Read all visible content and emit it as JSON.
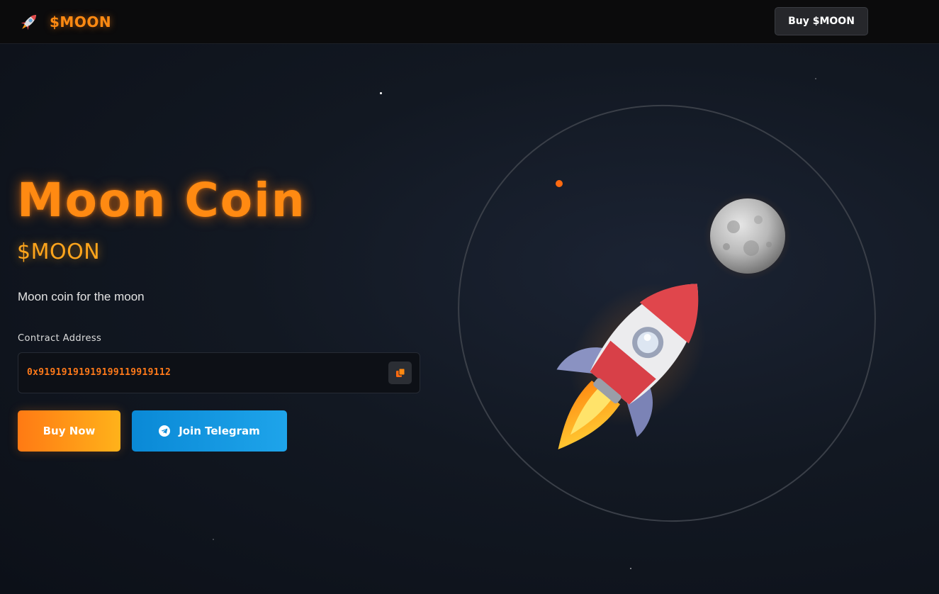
{
  "header": {
    "brand_name": "$MOON",
    "brand_icon": "rocket-icon",
    "buy_button_label": "Buy $MOON"
  },
  "hero": {
    "title": "Moon Coin",
    "ticker": "$MOON",
    "description": "Moon coin for the moon",
    "contract_label": "Contract Address",
    "contract_address": "0x91919191919199119919112",
    "copy_icon": "copy-icon",
    "buy_now_label": "Buy Now",
    "telegram_label": "Join Telegram",
    "telegram_icon": "telegram-icon"
  },
  "illustration": {
    "items": [
      "orbit-ring",
      "orbit-dot",
      "moon-image",
      "rocket-image"
    ]
  },
  "colors": {
    "accent": "#ff8a12",
    "ticker": "#ffa51c",
    "telegram": "#0a89d6",
    "background": "#121822"
  }
}
